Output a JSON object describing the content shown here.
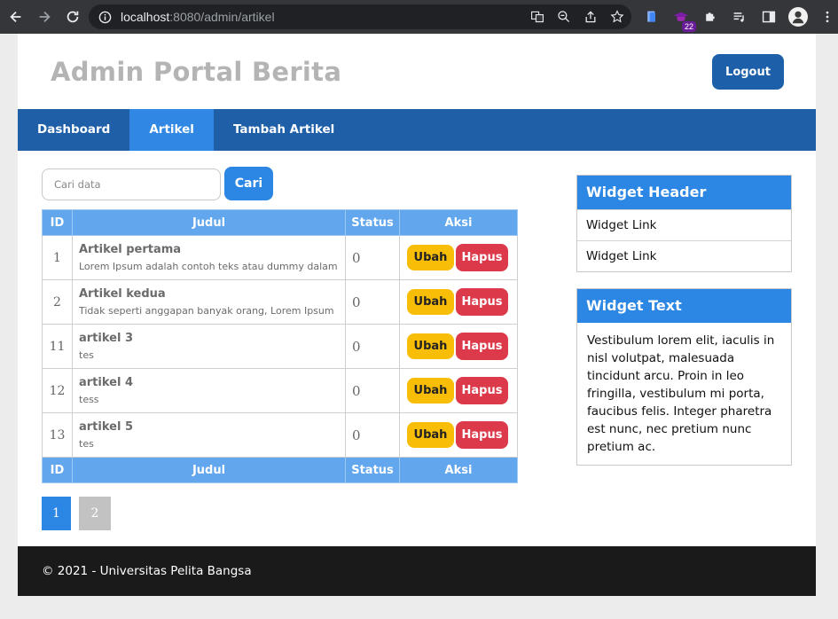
{
  "browser": {
    "url_host": "localhost",
    "url_rest": ":8080/admin/artikel",
    "extension_badge": "22"
  },
  "header": {
    "title": "Admin Portal Berita",
    "logout_label": "Logout"
  },
  "nav": {
    "items": [
      {
        "label": "Dashboard"
      },
      {
        "label": "Artikel"
      },
      {
        "label": "Tambah Artikel"
      }
    ],
    "active_index": 1
  },
  "search": {
    "placeholder": "Cari data",
    "button_label": "Cari"
  },
  "table": {
    "columns": [
      "ID",
      "Judul",
      "Status",
      "Aksi"
    ],
    "rows": [
      {
        "id": "1",
        "title": "Artikel pertama",
        "desc": "Lorem Ipsum adalah contoh teks atau dummy dalam i",
        "status": "0"
      },
      {
        "id": "2",
        "title": "Artikel kedua",
        "desc": "Tidak seperti anggapan banyak orang, Lorem Ipsum",
        "status": "0"
      },
      {
        "id": "11",
        "title": "artikel 3",
        "desc": "tes",
        "status": "0"
      },
      {
        "id": "12",
        "title": "artikel 4",
        "desc": "tess",
        "status": "0"
      },
      {
        "id": "13",
        "title": "artikel 5",
        "desc": "tes",
        "status": "0"
      }
    ],
    "edit_label": "Ubah",
    "delete_label": "Hapus"
  },
  "pagination": {
    "pages": [
      "1",
      "2"
    ],
    "current": "1"
  },
  "widgets": {
    "header_title": "Widget Header",
    "links": [
      "Widget Link",
      "Widget Link"
    ],
    "text_title": "Widget Text",
    "text_body": "Vestibulum lorem elit, iaculis in nisl volutpat, malesuada tincidunt arcu. Proin in leo fringilla, vestibulum mi porta, faucibus felis. Integer pharetra est nunc, nec pretium nunc pretium ac."
  },
  "footer": {
    "text": "© 2021 - Universitas Pelita Bangsa"
  },
  "colors": {
    "nav_bg": "#1e5fa8",
    "nav_active": "#3088e4",
    "table_head": "#62a6ee",
    "edit_btn": "#f8bd06",
    "delete_btn": "#dc3a4a",
    "footer_bg": "#1a1a1a"
  }
}
